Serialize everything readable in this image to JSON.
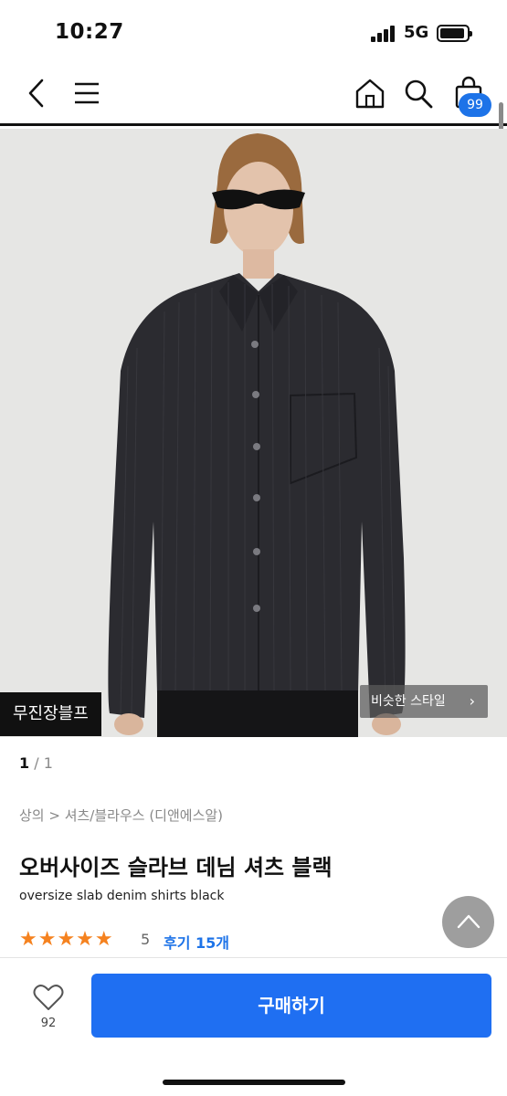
{
  "status_bar": {
    "time": "10:27",
    "network": "5G",
    "icons": [
      "signal-icon",
      "battery-icon"
    ]
  },
  "nav": {
    "icons": [
      "back-icon",
      "menu-icon",
      "home-icon",
      "search-icon",
      "cart-icon"
    ],
    "cart_badge": "99"
  },
  "product": {
    "brand_tag": "무진장블프",
    "similar_style_label": "비슷한 스타일",
    "image_page_current": "1",
    "image_page_total": "/ 1",
    "breadcrumb": "상의 > 셔츠/블라우스 (디앤에스알)",
    "title": "오버사이즈 슬라브 데님 셔츠 블랙",
    "subtitle": "oversize slab denim shirts black",
    "stars": "★★★★★",
    "rating_value": "5",
    "review_label": "후기 15개",
    "rating_fraction": 1.0
  },
  "bottom_bar": {
    "like_count": "92",
    "buy_label": "구매하기"
  },
  "colors": {
    "accent_blue": "#1f6ff2",
    "star_orange": "#f5821f",
    "badge_blue": "#1d73e8"
  }
}
